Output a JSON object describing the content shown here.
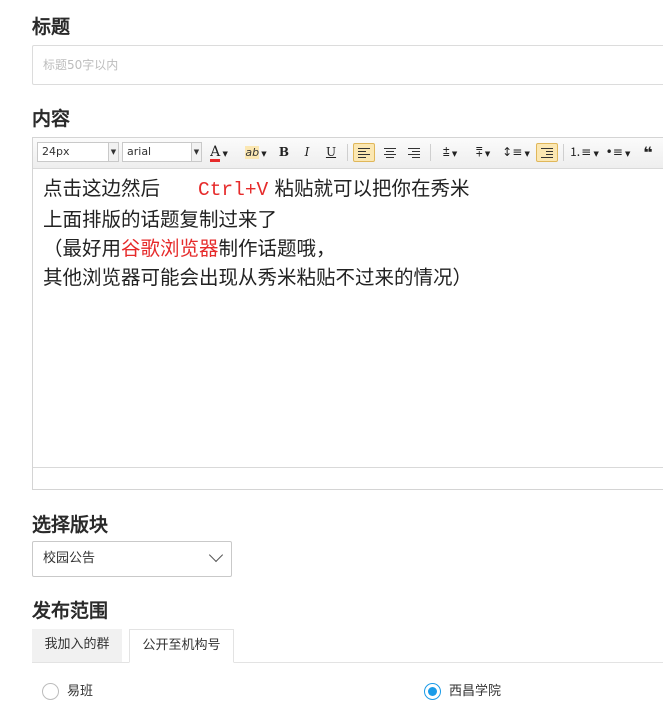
{
  "sections": {
    "title": "标题",
    "content": "内容",
    "board": "选择版块",
    "scope": "发布范围"
  },
  "title_input": {
    "value": "",
    "placeholder": "标题50字以内"
  },
  "editor": {
    "font_size": "24px",
    "font_family": "arial",
    "font_color_glyph": "A",
    "highlight_glyph": "ab",
    "bold_glyph": "B",
    "italic_glyph": "I",
    "underline_glyph": "U",
    "quote_glyph": "❝",
    "body": {
      "line1_a": "点击这边然后",
      "line1_key": "Ctrl+V",
      "line1_b": "粘贴就可以把你在秀米",
      "line2": "上面排版的话题复制过来了",
      "line3_a": "（最好用",
      "line3_red": "谷歌浏览器",
      "line3_b": "制作话题哦，",
      "line4": "其他浏览器可能会出现从秀米粘贴不过来的情况）"
    },
    "colors": {
      "accent_text": "#e62b2b",
      "active_button": "#fbe7b2"
    }
  },
  "board_select": {
    "value": "校园公告"
  },
  "scope_tabs": [
    {
      "label": "我加入的群",
      "active": false
    },
    {
      "label": "公开至机构号",
      "active": true
    }
  ],
  "scope_options": [
    {
      "label": "易班",
      "checked": false
    },
    {
      "label": "西昌学院",
      "checked": true
    }
  ],
  "accent_color": "#1a9be8"
}
